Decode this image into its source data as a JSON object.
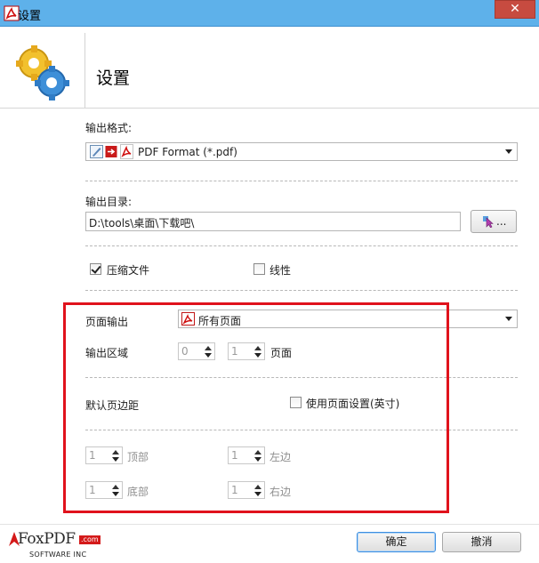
{
  "window": {
    "title": "设置",
    "close_symbol": "✕"
  },
  "header": {
    "heading": "设置"
  },
  "output_format": {
    "label": "输出格式:",
    "value": "PDF Format (*.pdf)"
  },
  "output_dir": {
    "label": "输出目录:",
    "value": "D:\\tools\\桌面\\下载吧\\",
    "browse_label": "..."
  },
  "options": {
    "compress": {
      "label": "压缩文件",
      "checked": true
    },
    "linear": {
      "label": "线性",
      "checked": false
    }
  },
  "page_output": {
    "label": "页面输出",
    "value": "所有页面"
  },
  "output_range": {
    "label": "输出区域",
    "from": "0",
    "to": "1",
    "unit": "页面"
  },
  "margins": {
    "label": "默认页边距",
    "use_page_settings": {
      "label": "使用页面设置(英寸)",
      "checked": false
    },
    "top": {
      "value": "1",
      "label": "顶部"
    },
    "left": {
      "value": "1",
      "label": "左边"
    },
    "bottom": {
      "value": "1",
      "label": "底部"
    },
    "right": {
      "value": "1",
      "label": "右边"
    }
  },
  "logo": {
    "brand": "FoxPDF",
    "domain": ".com",
    "tagline": "SOFTWARE INC"
  },
  "buttons": {
    "ok": "确定",
    "cancel": "撤消"
  },
  "colors": {
    "titlebar": "#5eb1ea",
    "highlight_box": "#e0121c",
    "close": "#c74b40"
  }
}
